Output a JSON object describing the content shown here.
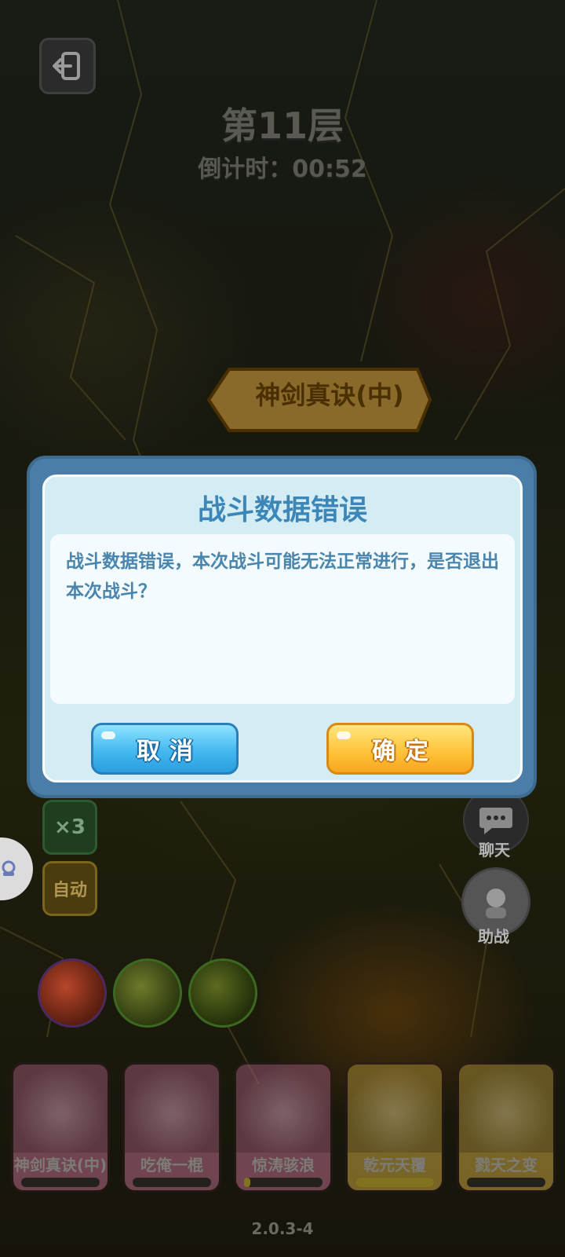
{
  "header": {
    "floor_title": "第11层",
    "countdown_label": "倒计时：",
    "countdown_value": "00:52"
  },
  "battle": {
    "skill_banner": "神剑真诀(中)",
    "speed_label": "×3",
    "auto_label": "自动",
    "chat_label": "聊天",
    "assist_label": "助战",
    "skill_cards": [
      {
        "name": "神剑真诀(中)",
        "progress": 0.0,
        "color": "#b86a8a"
      },
      {
        "name": "吃俺一棍",
        "progress": 0.0,
        "color": "#b86a8a"
      },
      {
        "name": "惊涛骇浪",
        "progress": 0.08,
        "color": "#b86a8a"
      },
      {
        "name": "乾元天覆",
        "progress": 1.0,
        "color": "#c8a640"
      },
      {
        "name": "戮天之变",
        "progress": 0.0,
        "color": "#c8a640"
      }
    ]
  },
  "dialog": {
    "title": "战斗数据错误",
    "message": "战斗数据错误，本次战斗可能无法正常进行，是否退出本次战斗？",
    "cancel_label": "取消",
    "confirm_label": "确定"
  },
  "footer": {
    "version": "2.0.3-4"
  }
}
